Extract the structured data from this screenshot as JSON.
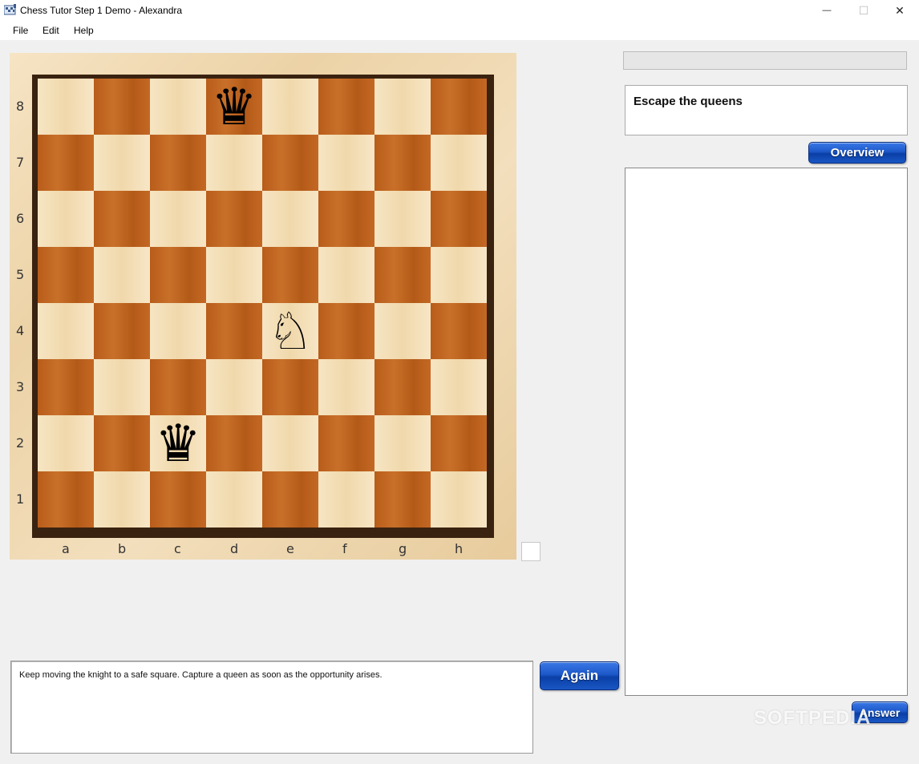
{
  "window": {
    "title": "Chess Tutor Step 1 Demo - Alexandra",
    "minimize_glyph": "—",
    "maximize_glyph": "☐",
    "close_glyph": "✕"
  },
  "menu": [
    "File",
    "Edit",
    "Help"
  ],
  "board": {
    "ranks": [
      "8",
      "7",
      "6",
      "5",
      "4",
      "3",
      "2",
      "1"
    ],
    "files": [
      "a",
      "b",
      "c",
      "d",
      "e",
      "f",
      "g",
      "h"
    ],
    "pieces": [
      {
        "square": "d8",
        "glyph": "♛",
        "name": "black-queen-d8"
      },
      {
        "square": "e4",
        "glyph": "♘",
        "name": "white-knight-e4"
      },
      {
        "square": "c2",
        "glyph": "♛",
        "name": "black-queen-c2"
      }
    ],
    "colors": {
      "light": "#f4dfb6",
      "dark": "#c0641f",
      "frame": "#3a2210"
    }
  },
  "instruction": "Keep moving the knight to a safe square. Capture a queen as soon as the opportunity arises.",
  "buttons": {
    "again": "Again",
    "overview": "Overview",
    "answer": "Answer"
  },
  "lesson_title": "Escape the queens",
  "watermark": "SOFTPEDIA"
}
